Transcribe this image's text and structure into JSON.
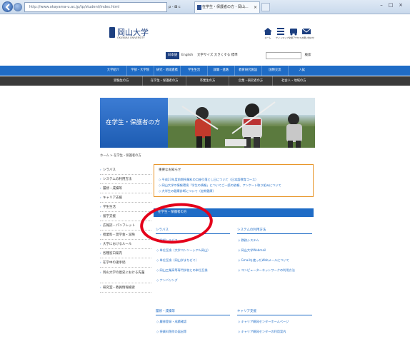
{
  "browser": {
    "address": "http://www.okayama-u.ac.jp/tp/student/index.html",
    "address_controls": "ρ - ⊠ c",
    "tab_title": "在学生・保護者の方 - 岡山...",
    "tab_close": "×",
    "window_controls": [
      "–",
      "□",
      "×"
    ]
  },
  "header": {
    "logo_text": "岡山大学",
    "logo_subtext": "OKAYAMA UNIVERSITY",
    "icons": [
      {
        "name": "home-icon",
        "label": "ホーム"
      },
      {
        "name": "sitemap-icon",
        "label": "サイトマップ"
      },
      {
        "name": "access-icon",
        "label": "交通アクセス"
      },
      {
        "name": "contact-icon",
        "label": "お問い合わせ"
      }
    ]
  },
  "utility": {
    "lang_jp": "日本語",
    "lang_en": "English",
    "font_size": "文字サイズ 大きくする 標準",
    "search_button": "検索"
  },
  "nav_primary": [
    "大学紹介",
    "学部・大学院",
    "研究・地域連携",
    "学生生活",
    "就職・進路",
    "教育研究施設",
    "国際交流",
    "入試"
  ],
  "nav_secondary": [
    "受験生の方",
    "在学生・保護者の方",
    "卒業生の方",
    "企業・研究者の方",
    "社会人・地域の方"
  ],
  "hero": {
    "title": "在学生・保護者の方"
  },
  "breadcrumb": "ホーム > 在学生・保護者の方",
  "sidebar": [
    "シラバス",
    "システムの利用方法",
    "履修・成績等",
    "キャリア支援",
    "学生生活",
    "留学支援",
    "広報誌・パンフレット",
    "授業料・奨学金・減免",
    "大学におけるルール",
    "各種窓口案内",
    "在学中の諸手続",
    "岡山大学の歴史における先輩",
    "研究室・教員情報検索"
  ],
  "notice": {
    "title": "重要なお知らせ",
    "lines": [
      "◇ 平成23年度前期授業料の口座引落とし日について（日本語教育コース）",
      "◇ 岡山大学の情報環境「学生の情報」についてご一読の依頼、アンケート取り組みについて",
      "◇ 大学生の健康診断について（定期健康）"
    ]
  },
  "section": {
    "heading": "在学生・保護者の方",
    "columns": [
      {
        "title": "シラバス",
        "links": [
          "◇ 学部シラバス",
          "◇ 単位互換（大学コンソーシアム岡山）",
          "◇ 単位互換（岡山学まちゼミ）",
          "◇ 岡山工業高等専門学校との単位互換",
          "◇ ナンバリング"
        ]
      },
      {
        "title": "システムの利用方法",
        "links": [
          "◇ 教務システム",
          "◇ 岡山大学Webmail",
          "◇ Gmailを使ったWebメールについて",
          "◇ コンピューターネットワークの利用方法"
        ]
      },
      {
        "title": "履修・成績等",
        "links": [
          "◇ 履修登録・成績確認",
          "◇ 授業料免除の届出等"
        ]
      },
      {
        "title": "キャリア支援",
        "links": [
          "◇ キャリア開発センターホームページ",
          "◇ キャリア開発センターの利用案内"
        ]
      }
    ]
  }
}
